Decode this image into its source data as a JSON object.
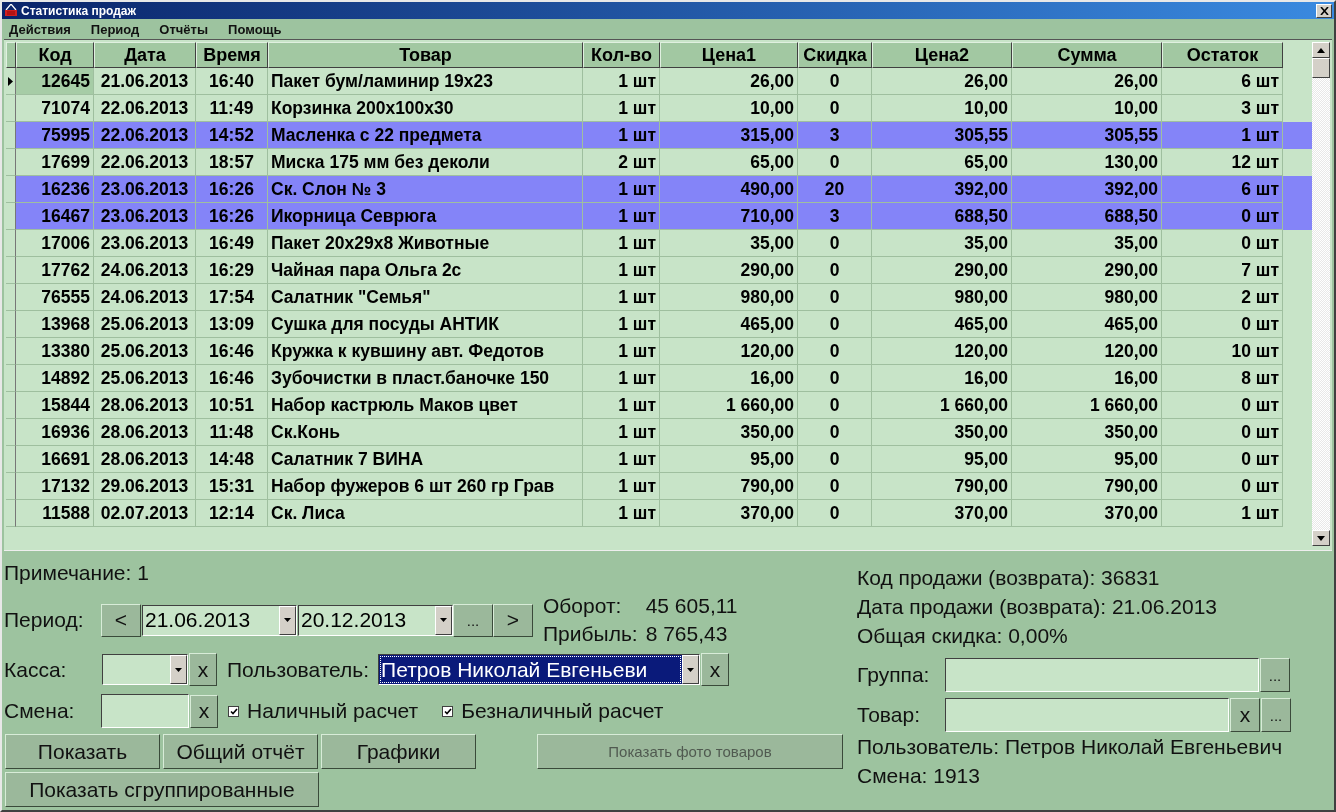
{
  "window": {
    "title": "Статистика продаж"
  },
  "menu": [
    "Действия",
    "Период",
    "Отчёты",
    "Помощь"
  ],
  "table": {
    "columns": [
      "Код",
      "Дата",
      "Время",
      "Товар",
      "Кол-во",
      "Цена1",
      "Скидка",
      "Цена2",
      "Сумма",
      "Остаток"
    ],
    "rows": [
      {
        "current": true,
        "selected": false,
        "cells": [
          "12645",
          "21.06.2013",
          "16:40",
          "Пакет бум/ламинир 19x23",
          "1 шт",
          "26,00",
          "0",
          "26,00",
          "26,00",
          "6 шт"
        ]
      },
      {
        "current": false,
        "selected": false,
        "cells": [
          "71074",
          "22.06.2013",
          "11:49",
          "Корзинка 200x100x30",
          "1 шт",
          "10,00",
          "0",
          "10,00",
          "10,00",
          "3 шт"
        ]
      },
      {
        "current": false,
        "selected": true,
        "cells": [
          "75995",
          "22.06.2013",
          "14:52",
          "Масленка с 22 предмета",
          "1 шт",
          "315,00",
          "3",
          "305,55",
          "305,55",
          "1 шт"
        ]
      },
      {
        "current": false,
        "selected": false,
        "cells": [
          "17699",
          "22.06.2013",
          "18:57",
          "Миска 175 мм без деколи",
          "2 шт",
          "65,00",
          "0",
          "65,00",
          "130,00",
          "12 шт"
        ]
      },
      {
        "current": false,
        "selected": true,
        "cells": [
          "16236",
          "23.06.2013",
          "16:26",
          "Ск. Слон № 3",
          "1 шт",
          "490,00",
          "20",
          "392,00",
          "392,00",
          "6 шт"
        ]
      },
      {
        "current": false,
        "selected": true,
        "cells": [
          "16467",
          "23.06.2013",
          "16:26",
          "Икорница Севрюга",
          "1 шт",
          "710,00",
          "3",
          "688,50",
          "688,50",
          "0 шт"
        ]
      },
      {
        "current": false,
        "selected": false,
        "cells": [
          "17006",
          "23.06.2013",
          "16:49",
          "Пакет 20x29x8 Животные",
          "1 шт",
          "35,00",
          "0",
          "35,00",
          "35,00",
          "0 шт"
        ]
      },
      {
        "current": false,
        "selected": false,
        "cells": [
          "17762",
          "24.06.2013",
          "16:29",
          "Чайная пара Ольга 2с",
          "1 шт",
          "290,00",
          "0",
          "290,00",
          "290,00",
          "7 шт"
        ]
      },
      {
        "current": false,
        "selected": false,
        "cells": [
          "76555",
          "24.06.2013",
          "17:54",
          "Салатник \"Семья\"",
          "1 шт",
          "980,00",
          "0",
          "980,00",
          "980,00",
          "2 шт"
        ]
      },
      {
        "current": false,
        "selected": false,
        "cells": [
          "13968",
          "25.06.2013",
          "13:09",
          "Сушка для посуды АНТИК",
          "1 шт",
          "465,00",
          "0",
          "465,00",
          "465,00",
          "0 шт"
        ]
      },
      {
        "current": false,
        "selected": false,
        "cells": [
          "13380",
          "25.06.2013",
          "16:46",
          "Кружка к кувшину авт. Федотов",
          "1 шт",
          "120,00",
          "0",
          "120,00",
          "120,00",
          "10 шт"
        ]
      },
      {
        "current": false,
        "selected": false,
        "cells": [
          "14892",
          "25.06.2013",
          "16:46",
          "Зубочистки в пласт.баночке 150",
          "1 шт",
          "16,00",
          "0",
          "16,00",
          "16,00",
          "8 шт"
        ]
      },
      {
        "current": false,
        "selected": false,
        "cells": [
          "15844",
          "28.06.2013",
          "10:51",
          "Набор кастрюль Маков цвет",
          "1 шт",
          "1 660,00",
          "0",
          "1 660,00",
          "1 660,00",
          "0 шт"
        ]
      },
      {
        "current": false,
        "selected": false,
        "cells": [
          "16936",
          "28.06.2013",
          "11:48",
          "Ск.Конь",
          "1 шт",
          "350,00",
          "0",
          "350,00",
          "350,00",
          "0 шт"
        ]
      },
      {
        "current": false,
        "selected": false,
        "cells": [
          "16691",
          "28.06.2013",
          "14:48",
          "Салатник 7 ВИНА",
          "1 шт",
          "95,00",
          "0",
          "95,00",
          "95,00",
          "0 шт"
        ]
      },
      {
        "current": false,
        "selected": false,
        "cells": [
          "17132",
          "29.06.2013",
          "15:31",
          "Набор фужеров 6 шт 260 гр Грав",
          "1 шт",
          "790,00",
          "0",
          "790,00",
          "790,00",
          "0 шт"
        ]
      },
      {
        "current": false,
        "selected": false,
        "cells": [
          "11588",
          "02.07.2013",
          "12:14",
          "Ск. Лиса",
          "1 шт",
          "370,00",
          "0",
          "370,00",
          "370,00",
          "1 шт"
        ]
      }
    ]
  },
  "note": "Примечание: 1",
  "period": {
    "label": "Период:",
    "prev": "<",
    "from": "21.06.2013",
    "to": "20.12.2013",
    "more": "...",
    "next": ">"
  },
  "stats": [
    {
      "label": "Оборот:",
      "value": "45 605,11"
    },
    {
      "label": "Прибыль:",
      "value": "8 765,43"
    }
  ],
  "kassa": {
    "label": "Касса:",
    "clear": "x"
  },
  "user_filter": {
    "label": "Пользователь:",
    "value": "Петров Николай Евгеньеви",
    "clear": "x"
  },
  "shift": {
    "label": "Смена:",
    "clear": "x"
  },
  "checkboxes": [
    {
      "label": "Наличный расчет",
      "checked": true
    },
    {
      "label": "Безналичный расчет",
      "checked": true
    }
  ],
  "buttons": [
    "Показать",
    "Общий отчёт",
    "Графики"
  ],
  "photo_button": {
    "label": "Показать фото товаров",
    "disabled": true
  },
  "group_button": "Показать сгруппированные",
  "info": [
    "Код продажи (возврата): 36831",
    "Дата продажи (возврата): 21.06.2013",
    "Общая скидка: 0,00%"
  ],
  "group": {
    "label": "Группа:",
    "browse": "..."
  },
  "product": {
    "label": "Товар:",
    "clear": "x",
    "browse": "..."
  },
  "info2": [
    "Пользователь: Петров Николай Евгеньевич",
    "Смена: 1913"
  ]
}
